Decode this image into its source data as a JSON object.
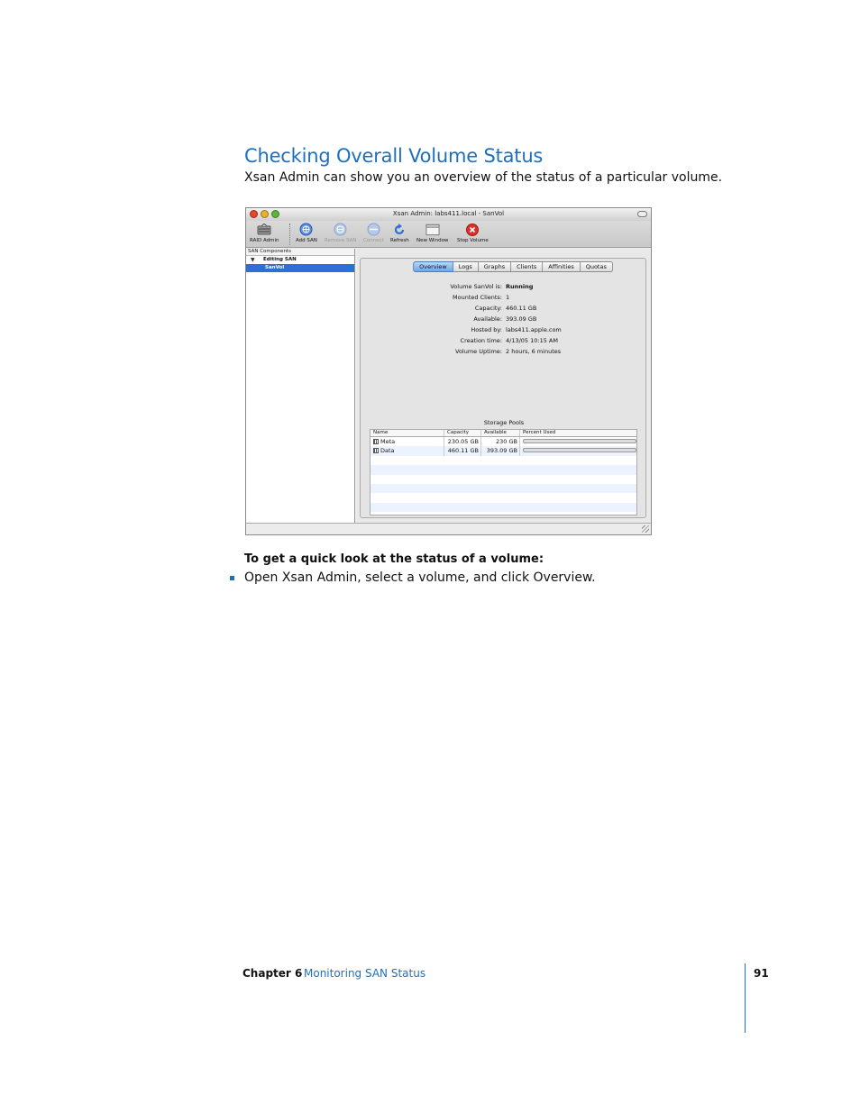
{
  "section": {
    "heading": "Checking Overall Volume Status",
    "intro": "Xsan Admin can show you an overview of the status of a particular volume."
  },
  "window": {
    "title": "Xsan Admin: labs411.local - SanVol",
    "toolbar": [
      {
        "label": "RAID Admin",
        "icon": "raid-admin-icon",
        "enabled": true
      },
      {
        "label": "Add SAN",
        "icon": "add-san-icon",
        "enabled": true
      },
      {
        "label": "Remove SAN",
        "icon": "remove-san-icon",
        "enabled": false
      },
      {
        "label": "Connect",
        "icon": "connect-icon",
        "enabled": false
      },
      {
        "label": "Refresh",
        "icon": "refresh-icon",
        "enabled": true
      },
      {
        "label": "New Window",
        "icon": "new-window-icon",
        "enabled": true
      },
      {
        "label": "Stop Volume",
        "icon": "stop-volume-icon",
        "enabled": true
      }
    ],
    "sidebar": {
      "header": "SAN Components",
      "group": "Editing SAN",
      "selected_item": "SanVol"
    },
    "tabs": [
      "Overview",
      "Logs",
      "Graphs",
      "Clients",
      "Affinities",
      "Quotas"
    ],
    "active_tab": "Overview",
    "overview": [
      {
        "key": "Volume SanVol is:",
        "value": "Running"
      },
      {
        "key": "Mounted Clients:",
        "value": "1"
      },
      {
        "key": "Capacity:",
        "value": "460.11 GB"
      },
      {
        "key": "Available:",
        "value": "393.09 GB"
      },
      {
        "key": "Hosted by:",
        "value": "labs411.apple.com"
      },
      {
        "key": "Creation time:",
        "value": "4/13/05 10:15 AM"
      },
      {
        "key": "Volume Uptime:",
        "value": "2 hours, 6 minutes"
      }
    ],
    "storage_pools": {
      "title": "Storage Pools",
      "columns": [
        "Name",
        "Capacity",
        "Available",
        "Percent Used"
      ],
      "rows": [
        {
          "name": "Meta",
          "capacity": "230.05 GB",
          "available": "230 GB",
          "percent_used": 0.0
        },
        {
          "name": "Data",
          "capacity": "460.11 GB",
          "available": "393.09 GB",
          "percent_used": 14.6
        }
      ]
    }
  },
  "procedure": {
    "heading": "To get a quick look at the status of a volume:",
    "steps": [
      "Open Xsan Admin, select a volume, and click Overview."
    ]
  },
  "footer": {
    "chapter": "Chapter 6",
    "title": "Monitoring SAN Status",
    "page": "91"
  },
  "colors": {
    "accent": "#1f6fbf",
    "selection": "#2d6fd6",
    "progress": "#4cae29"
  }
}
